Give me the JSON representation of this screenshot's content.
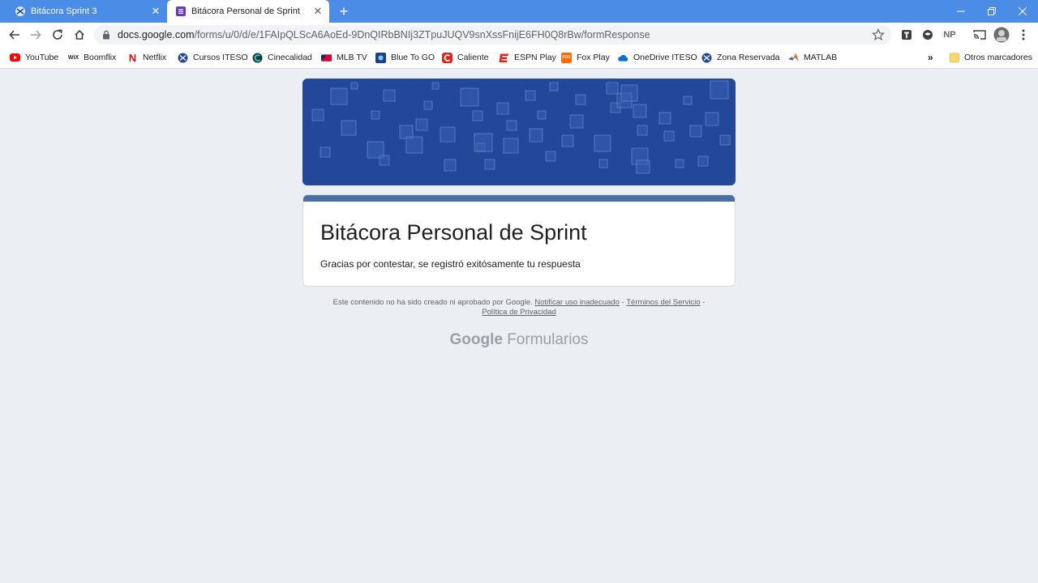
{
  "tabs": [
    {
      "title": "Bitácora Sprint 3"
    },
    {
      "title": "Bitácora Personal de Sprint"
    }
  ],
  "omnibox": {
    "host": "docs.google.com",
    "path": "/forms/u/0/d/e/1FAIpQLScA6AoEd-9DnQIRbBNIj3ZTpuJUQV9snXssFnijE6FH0Q8rBw/formResponse"
  },
  "extensions": {
    "np_label": "NP"
  },
  "bookmarks": [
    {
      "label": "YouTube",
      "icon": "youtube-icon"
    },
    {
      "label": "Boomflix",
      "icon": "wix-icon"
    },
    {
      "label": "Netflix",
      "icon": "netflix-icon"
    },
    {
      "label": "Cursos ITESO",
      "icon": "iteso-icon"
    },
    {
      "label": "Cinecalidad",
      "icon": "cinecalidad-icon"
    },
    {
      "label": "MLB TV",
      "icon": "mlb-icon"
    },
    {
      "label": "Blue To GO",
      "icon": "bluetogo-icon"
    },
    {
      "label": "Caliente",
      "icon": "caliente-icon"
    },
    {
      "label": "ESPN Play",
      "icon": "espn-icon"
    },
    {
      "label": "Fox Play",
      "icon": "fox-icon"
    },
    {
      "label": "OneDrive ITESO",
      "icon": "onedrive-icon"
    },
    {
      "label": "Zona Reservada",
      "icon": "iteso-icon"
    },
    {
      "label": "MATLAB",
      "icon": "matlab-icon"
    }
  ],
  "bookmarks_overflow": "»",
  "other_bookmarks": "Otros marcadores",
  "form": {
    "title": "Bitácora Personal de Sprint",
    "message": "Gracias por contestar, se registró exitósamente tu respuesta"
  },
  "footer": {
    "text": "Este contenido no ha sido creado ni aprobado por Google.",
    "report_link": "Notificar uso inadecuado",
    "sep": " - ",
    "terms_link": "Términos del Servicio",
    "privacy_link": "Política de Privacidad"
  },
  "brand": {
    "google": "Google",
    "product": "Formularios"
  },
  "colors": {
    "tab_bar": "#4a8ce6",
    "banner": "#23489a",
    "card_accent": "#4a6fa5",
    "page_bg": "#ebeef3"
  }
}
